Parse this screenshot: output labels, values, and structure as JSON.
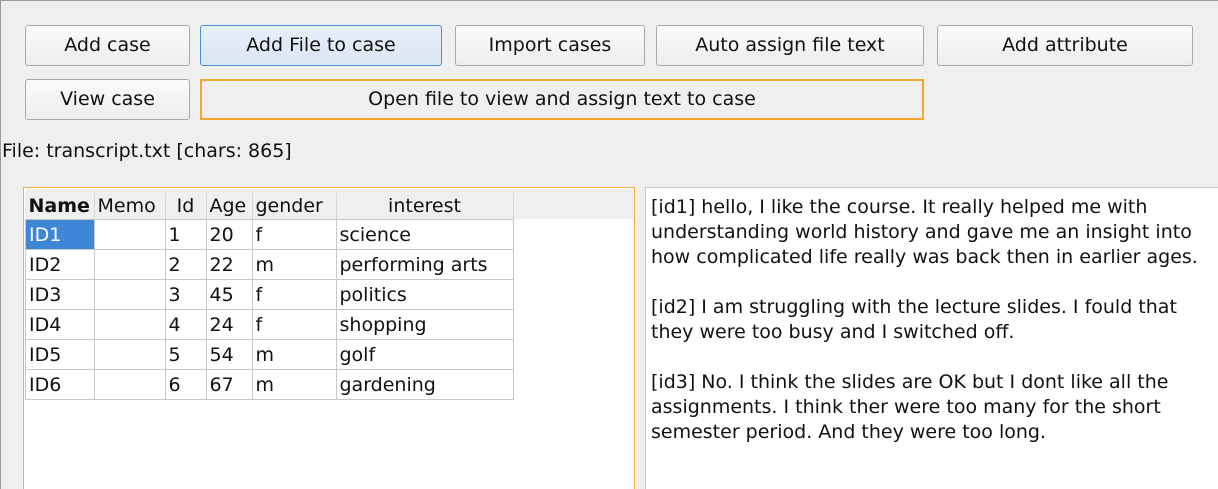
{
  "toolbar": {
    "add_case": "Add case",
    "add_file_to_case": "Add File to case",
    "import_cases": "Import cases",
    "auto_assign": "Auto assign file text",
    "add_attribute": "Add attribute",
    "view_case": "View case",
    "open_file": "Open file to view and assign text to case"
  },
  "file_info": "File: transcript.txt [chars: 865]",
  "table": {
    "columns": [
      "Name",
      "Memo",
      "Id",
      "Age",
      "gender",
      "interest"
    ],
    "rows": [
      [
        "ID1",
        "",
        "1",
        "20",
        "f",
        "science"
      ],
      [
        "ID2",
        "",
        "2",
        "22",
        "m",
        "performing arts"
      ],
      [
        "ID3",
        "",
        "3",
        "45",
        "f",
        "politics"
      ],
      [
        "ID4",
        "",
        "4",
        "24",
        "f",
        "shopping"
      ],
      [
        "ID5",
        "",
        "5",
        "54",
        "m",
        "golf"
      ],
      [
        "ID6",
        "",
        "6",
        "67",
        "m",
        "gardening"
      ]
    ],
    "selected_cell": "ID1"
  },
  "text_view": {
    "paragraphs": [
      "[id1] hello, I like the course. It really helped me with understanding world history and gave me an insight into how complicated life really was back then in earlier ages.",
      "[id2] I am struggling with the lecture slides. I fould that they were too busy and I switched off.",
      "[id3] No. I think the slides are OK but I dont like all the assignments. I think ther were too many for the short semester period. And they were too long."
    ]
  },
  "colors": {
    "selection": "#3d87d6",
    "focus_border": "#f0a830",
    "button_focus": "#4a90d9"
  }
}
